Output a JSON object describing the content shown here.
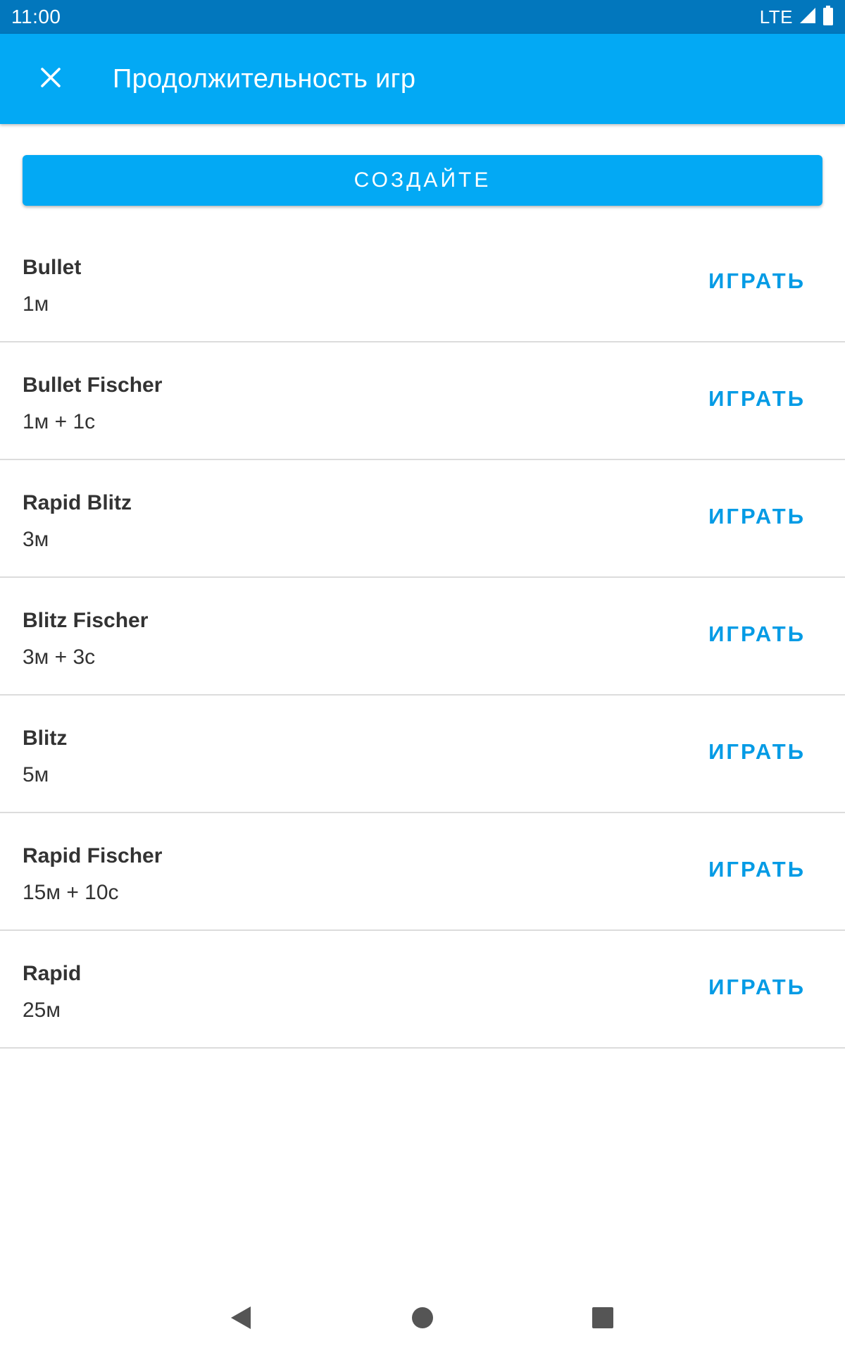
{
  "status_bar": {
    "time": "11:00",
    "network": "LTE"
  },
  "app_bar": {
    "title": "Продолжительность игр",
    "close_icon": "close-icon"
  },
  "create_button": {
    "label": "СОЗДАЙТЕ"
  },
  "time_controls": [
    {
      "name": "Bullet",
      "time": "1м",
      "action": "ИГРАТЬ"
    },
    {
      "name": "Bullet Fischer",
      "time": "1м + 1с",
      "action": "ИГРАТЬ"
    },
    {
      "name": "Rapid Blitz",
      "time": "3м",
      "action": "ИГРАТЬ"
    },
    {
      "name": "Blitz Fischer",
      "time": "3м + 3с",
      "action": "ИГРАТЬ"
    },
    {
      "name": "Blitz",
      "time": "5м",
      "action": "ИГРАТЬ"
    },
    {
      "name": "Rapid Fischer",
      "time": "15м + 10с",
      "action": "ИГРАТЬ"
    },
    {
      "name": "Rapid",
      "time": "25м",
      "action": "ИГРАТЬ"
    }
  ],
  "nav_bar": {
    "back_icon": "back-icon",
    "home_icon": "home-icon",
    "recents_icon": "recents-icon"
  },
  "colors": {
    "status_bar": "#0277bd",
    "primary": "#03a9f4",
    "action_text": "#039be5",
    "divider": "#dcdcdc"
  }
}
